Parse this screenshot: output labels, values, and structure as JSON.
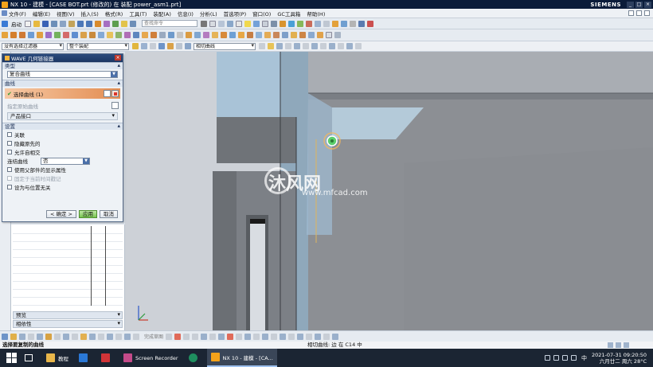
{
  "window": {
    "title": "NX 10 - 建模 - [CASE BOT.prt  (修改的)   在 装配 power_asm1.prt]",
    "brand": "SIEMENS",
    "buttons": [
      "_",
      "□",
      "×"
    ]
  },
  "menu": {
    "items": [
      "文件(F)",
      "编辑(E)",
      "视图(V)",
      "插入(S)",
      "格式(R)",
      "工具(T)",
      "装配(A)",
      "信息(I)",
      "分析(L)",
      "首选项(P)",
      "窗口(O)",
      "GC工具箱",
      "帮助(H)"
    ]
  },
  "toolbar1": {
    "start_label": "启动",
    "search_placeholder": "查找命令"
  },
  "selection_bar": {
    "filter": "没有选择过滤器",
    "scope": "整个装配",
    "curve_rule": "相切曲线"
  },
  "dialog": {
    "title": "WAVE 几何链接器",
    "type_group": "类型",
    "type_value": "复合曲线",
    "curve_group": "曲线",
    "select_curve": "选择曲线 (1)",
    "specify_origin": "指定原始曲线",
    "product_interface": "产品接口",
    "settings_group": "设置",
    "options": [
      {
        "label": "关联",
        "enabled": true
      },
      {
        "label": "隐藏原先的",
        "enabled": true
      },
      {
        "label": "允许自相交",
        "enabled": true
      }
    ],
    "join_curves_label": "连结曲线",
    "join_curves_value": "否",
    "options2": [
      {
        "label": "使用父部件的显示属性",
        "enabled": true
      },
      {
        "label": "固定于当前时间戳记",
        "enabled": false
      },
      {
        "label": "设为与位置无关",
        "enabled": true
      }
    ],
    "ok": "< 确定 >",
    "apply": "应用",
    "cancel": "取消"
  },
  "navigator": {
    "preview": "预览",
    "dependencies": "相依性"
  },
  "watermark": {
    "brand": "沐风网",
    "url": "www.mfcad.com"
  },
  "status": {
    "prompt": "选择要复制的曲线",
    "info": "相切曲线: 边 在 C14 中"
  },
  "bottom_toolbar": {
    "label": "完成草图"
  },
  "taskbar": {
    "apps": [
      {
        "label": "教程",
        "color": "#e8b64a",
        "active": false
      },
      {
        "label": "",
        "color": "#2a78d6",
        "active": false
      },
      {
        "label": "",
        "color": "#d13438",
        "active": false
      },
      {
        "label": "Screen Recorder",
        "color": "#c44b8a",
        "active": false
      },
      {
        "label": "",
        "color": "#1f8f5f",
        "active": false
      },
      {
        "label": "NX 10 - 建模 - [CA...",
        "color": "#f4a21a",
        "active": true
      }
    ],
    "lang": "中",
    "date": "2021-07-31 09:20:50",
    "weather": "六月廿二 周六 28°C"
  },
  "colors": {
    "viewport_bg": "#cfd3d9",
    "title_bg": "#0b1c3a",
    "accent_orange": "#e38d52"
  }
}
